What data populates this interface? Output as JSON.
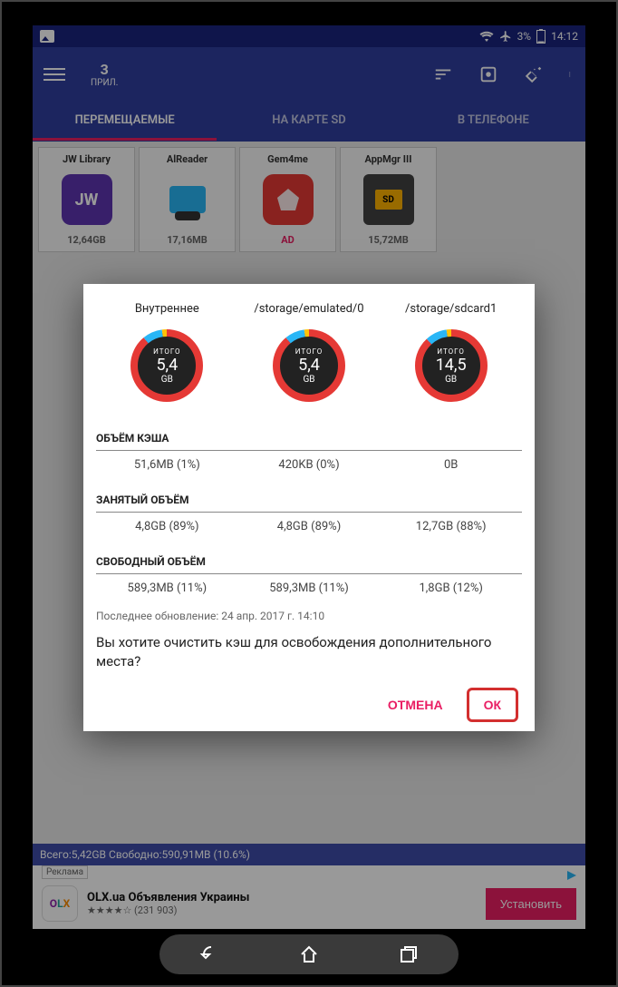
{
  "status": {
    "battery": "3%",
    "time": "14:12"
  },
  "header": {
    "count": "3",
    "count_label": "ПРИЛ."
  },
  "tabs": {
    "movable": "ПЕРЕМЕЩАЕМЫЕ",
    "sdcard": "НА КАРТЕ SD",
    "phone": "В ТЕЛЕФОНЕ"
  },
  "apps": [
    {
      "name": "JW Library",
      "size": "12,64GB"
    },
    {
      "name": "AlReader",
      "size": "17,16MB"
    },
    {
      "name": "Gem4me",
      "size": "AD"
    },
    {
      "name": "AppMgr III",
      "size": "15,72MB"
    }
  ],
  "dialog": {
    "storages": [
      {
        "path": "Внутреннее",
        "total_label": "ИТОГО",
        "value": "5,4",
        "unit": "GB",
        "used_pct": 89
      },
      {
        "path": "/storage/emulated/0",
        "total_label": "ИТОГО",
        "value": "5,4",
        "unit": "GB",
        "used_pct": 89
      },
      {
        "path": "/storage/sdcard1",
        "total_label": "ИТОГО",
        "value": "14,5",
        "unit": "GB",
        "used_pct": 88
      }
    ],
    "cache_title": "ОБЪЁМ КЭША",
    "cache": [
      "51,6MB (1%)",
      "420KB (0%)",
      "0B"
    ],
    "used_title": "ЗАНЯТЫЙ ОБЪЁМ",
    "used": [
      "4,8GB (89%)",
      "4,8GB (89%)",
      "12,7GB (88%)"
    ],
    "free_title": "СВОБОДНЫЙ ОБЪЁМ",
    "free": [
      "589,3MB (11%)",
      "589,3MB (11%)",
      "1,8GB (12%)"
    ],
    "updated": "Последнее обновление: 24 апр. 2017 г. 14:10",
    "question": "Вы хотите очистить кэш для освобождения дополнительного места?",
    "cancel": "ОТМЕНА",
    "ok": "ОК"
  },
  "footer_storage": "Всего:5,42GB Свободно:590,91MB (10.6%)",
  "ad": {
    "label": "Реклама",
    "title": "OLX.ua Объявления Украины",
    "rating_stars": "★★★★☆",
    "rating_count": "(231 903)",
    "install": "Установить",
    "olx_c1": "O",
    "olx_c2": "L",
    "olx_c3": "X"
  }
}
